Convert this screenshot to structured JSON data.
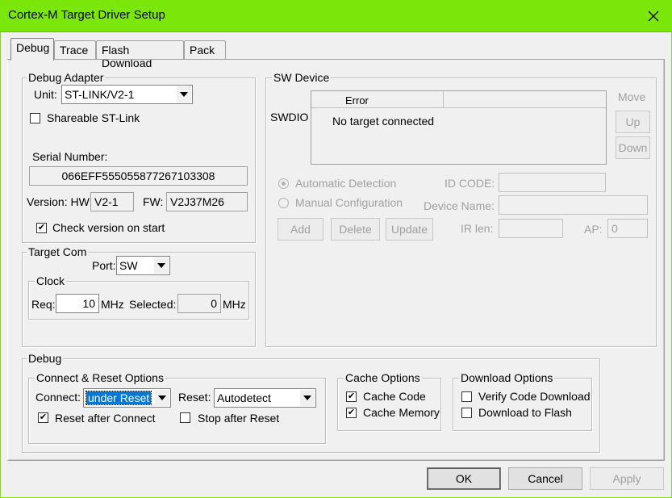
{
  "window": {
    "title": "Cortex-M Target Driver Setup"
  },
  "tabs": [
    {
      "label": "Debug"
    },
    {
      "label": "Trace"
    },
    {
      "label": "Flash Download"
    },
    {
      "label": "Pack"
    }
  ],
  "debug_adapter": {
    "legend": "Debug Adapter",
    "unit_label": "Unit:",
    "unit_value": "ST-LINK/V2-1",
    "shareable_label": "Shareable ST-Link",
    "serial_label": "Serial Number:",
    "serial_value": "066EFF555055877267103308",
    "version_label": "Version: HW:",
    "hw_value": "V2-1",
    "fw_label": "FW:",
    "fw_value": "V2J37M26",
    "check_version_label": "Check version on start"
  },
  "sw_device": {
    "legend": "SW Device",
    "move_label": "Move",
    "up_label": "Up",
    "down_label": "Down",
    "swdio_label": "SWDIO",
    "col_error": "Error",
    "row_text": "No target connected",
    "auto_detect": "Automatic Detection",
    "manual_config": "Manual Configuration",
    "id_code_label": "ID CODE:",
    "device_name_label": "Device Name:",
    "add_label": "Add",
    "delete_label": "Delete",
    "update_label": "Update",
    "ir_len_label": "IR len:",
    "ap_label": "AP:",
    "ap_value": "0"
  },
  "target_com": {
    "legend": "Target Com",
    "port_label": "Port:",
    "port_value": "SW",
    "clock_legend": "Clock",
    "req_label": "Req:",
    "req_value": "10",
    "mhz1": "MHz",
    "selected_label": "Selected:",
    "selected_value": "0",
    "mhz2": "MHz"
  },
  "debug": {
    "legend": "Debug",
    "connect_reset_legend": "Connect & Reset Options",
    "connect_label": "Connect:",
    "connect_value": "under Reset",
    "reset_label": "Reset:",
    "reset_value": "Autodetect",
    "reset_after_connect": "Reset after Connect",
    "stop_after_reset": "Stop after Reset",
    "cache_legend": "Cache Options",
    "cache_code": "Cache Code",
    "cache_memory": "Cache Memory",
    "download_legend": "Download Options",
    "verify_code": "Verify Code Download",
    "download_flash": "Download to Flash"
  },
  "footer": {
    "ok_label": "OK",
    "cancel_label": "Cancel",
    "apply_label": "Apply"
  }
}
